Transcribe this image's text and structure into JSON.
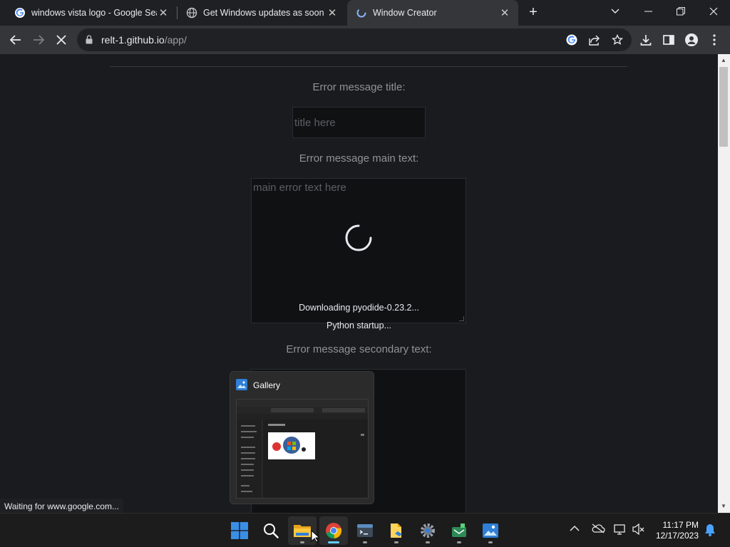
{
  "browser": {
    "tabs": [
      {
        "title": "windows vista logo - Google Sea",
        "favicon": "google-icon"
      },
      {
        "title": "Get Windows updates as soon as",
        "favicon": "globe-icon"
      },
      {
        "title": "Window Creator",
        "favicon": "loading-icon"
      }
    ],
    "url_host": "relt-1.github.io",
    "url_path": "/app/",
    "status": "Waiting for www.google.com..."
  },
  "form": {
    "title_label": "Error message title:",
    "title_placeholder": "title here",
    "main_label": "Error message main text:",
    "main_placeholder": "main error text here",
    "secondary_label": "Error message secondary text:",
    "loading_line1": "Downloading pyodide-0.23.2...",
    "loading_line2": "Python startup..."
  },
  "taskbar_preview": {
    "title": "Gallery"
  },
  "taskbar": {
    "apps": [
      "start-icon",
      "search-icon",
      "file-explorer-icon",
      "chrome-icon",
      "terminal-icon",
      "files-icon",
      "settings-icon",
      "photos-app-icon",
      "gallery-icon"
    ],
    "time": "11:17 PM",
    "date": "12/17/2023"
  },
  "colors": {
    "background": "#1a1b1e",
    "toolbar": "#35363a",
    "accent": "#60cdff"
  }
}
